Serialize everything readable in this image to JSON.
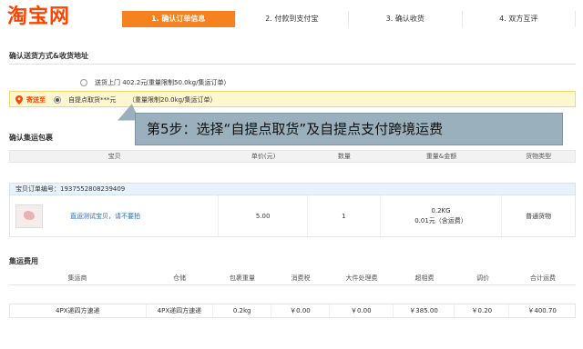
{
  "logo": {
    "text": "淘宝网"
  },
  "steps": [
    {
      "label": "1. 确认订单信息",
      "active": true
    },
    {
      "label": "2. 付款到支付宝",
      "active": false
    },
    {
      "label": "3. 确认收货",
      "active": false
    },
    {
      "label": "4. 双方互评",
      "active": false
    }
  ],
  "shipping": {
    "section_title": "确认送货方式&收货地址",
    "send_to_label": "寄送至",
    "options": [
      {
        "label": "送货上门 402.2元",
        "note": "（重量限制50.0kg/集运订单）",
        "selected": false
      },
      {
        "label": "自提点取货***元",
        "note": "（重量限制20.0kg/集运订单）",
        "selected": true
      }
    ]
  },
  "callout": {
    "text": "第5步：选择“自提点取货”及自提点支付跨境运费"
  },
  "package": {
    "section_title": "确认集运包裹",
    "headers": [
      "宝贝",
      "单价(元)",
      "数量",
      "重量&金额",
      "货物类型"
    ],
    "order_number_label": "宝贝订单编号：",
    "order_number": "1937552808239409",
    "item": {
      "name": "直运测试宝贝，请不要拍",
      "price": "5.00",
      "quantity": "1",
      "weight": "0.2KG",
      "amount": "0.01元（含运费）",
      "goods_type": "普通货物"
    }
  },
  "fees": {
    "section_title": "集运费用",
    "headers": [
      "集运商",
      "仓储",
      "包裹重量",
      "消费税",
      "大件处理费",
      "超相费",
      "调价",
      "合计运费"
    ],
    "row": [
      "4PX递四方速递",
      "4PX递四方速递",
      "0.2kg",
      "￥0.00",
      "￥0.00",
      "￥385.00",
      "￥0.20",
      "￥400.70"
    ]
  },
  "colors": {
    "brand": "#f40",
    "step_active": "#f5811f",
    "selected_bg": "#fff7cf",
    "callout_bg": "#9bb0bd"
  }
}
